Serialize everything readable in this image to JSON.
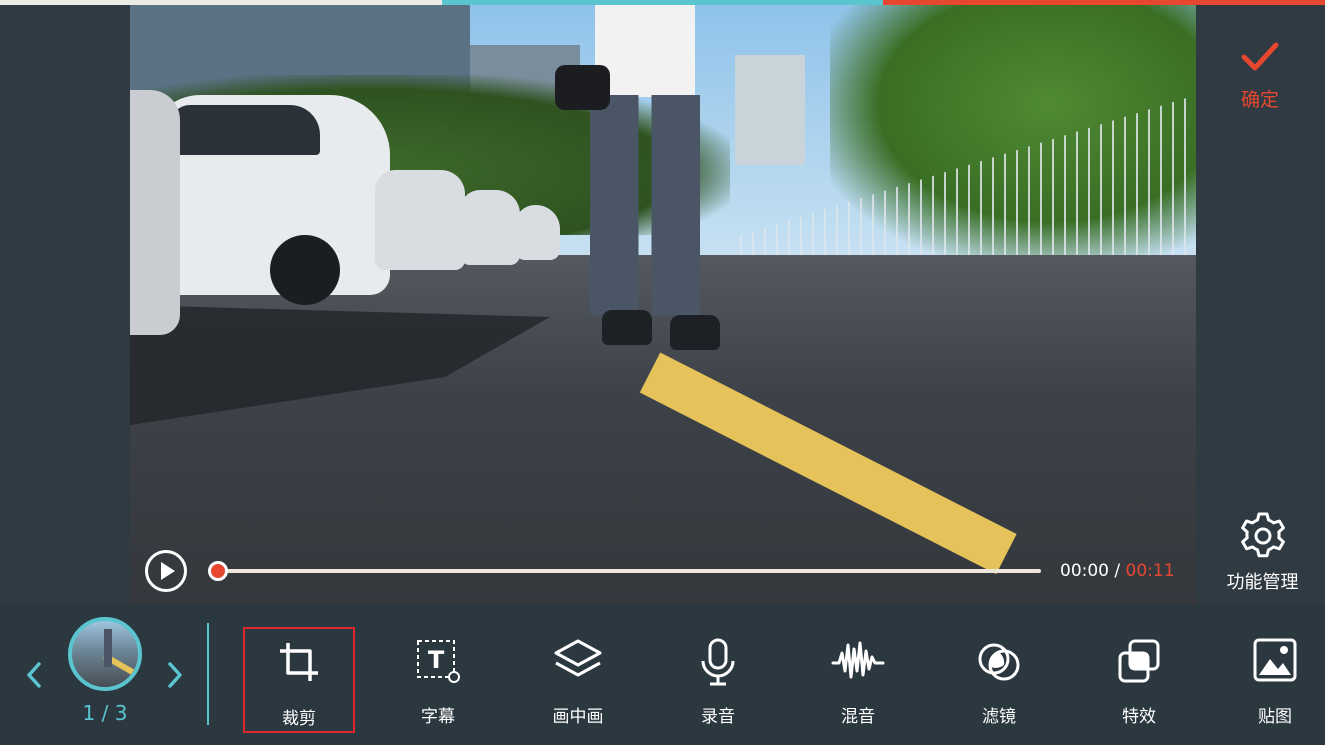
{
  "colors": {
    "accent_red": "#e8472f",
    "accent_teal": "#5ac4cf",
    "selected_border": "#e0262d",
    "background": "#2f3a42",
    "top_strip": [
      "#ecebe6",
      "#5ac4cf",
      "#e8472f"
    ]
  },
  "player": {
    "current_time": "00:00",
    "separator": "/",
    "total_time": "00:11",
    "progress": 0.0,
    "play_icon": "play-icon"
  },
  "right_panel": {
    "confirm_label": "确定",
    "confirm_icon": "check-icon",
    "manage_label": "功能管理",
    "manage_icon": "gear-icon"
  },
  "clip_nav": {
    "page_indicator": "1 / 3",
    "prev_icon": "chevron-left-icon",
    "next_icon": "chevron-right-icon"
  },
  "tools": [
    {
      "id": "crop",
      "label": "裁剪",
      "icon": "crop-icon",
      "selected": true
    },
    {
      "id": "subtitle",
      "label": "字幕",
      "icon": "text-icon",
      "selected": false
    },
    {
      "id": "pip",
      "label": "画中画",
      "icon": "layers-icon",
      "selected": false
    },
    {
      "id": "record",
      "label": "录音",
      "icon": "microphone-icon",
      "selected": false
    },
    {
      "id": "mix",
      "label": "混音",
      "icon": "waveform-icon",
      "selected": false
    },
    {
      "id": "filter",
      "label": "滤镜",
      "icon": "filter-circles-icon",
      "selected": false
    },
    {
      "id": "effects",
      "label": "特效",
      "icon": "effects-squares-icon",
      "selected": false
    },
    {
      "id": "sticker",
      "label": "贴图",
      "icon": "image-icon",
      "selected": false
    }
  ]
}
